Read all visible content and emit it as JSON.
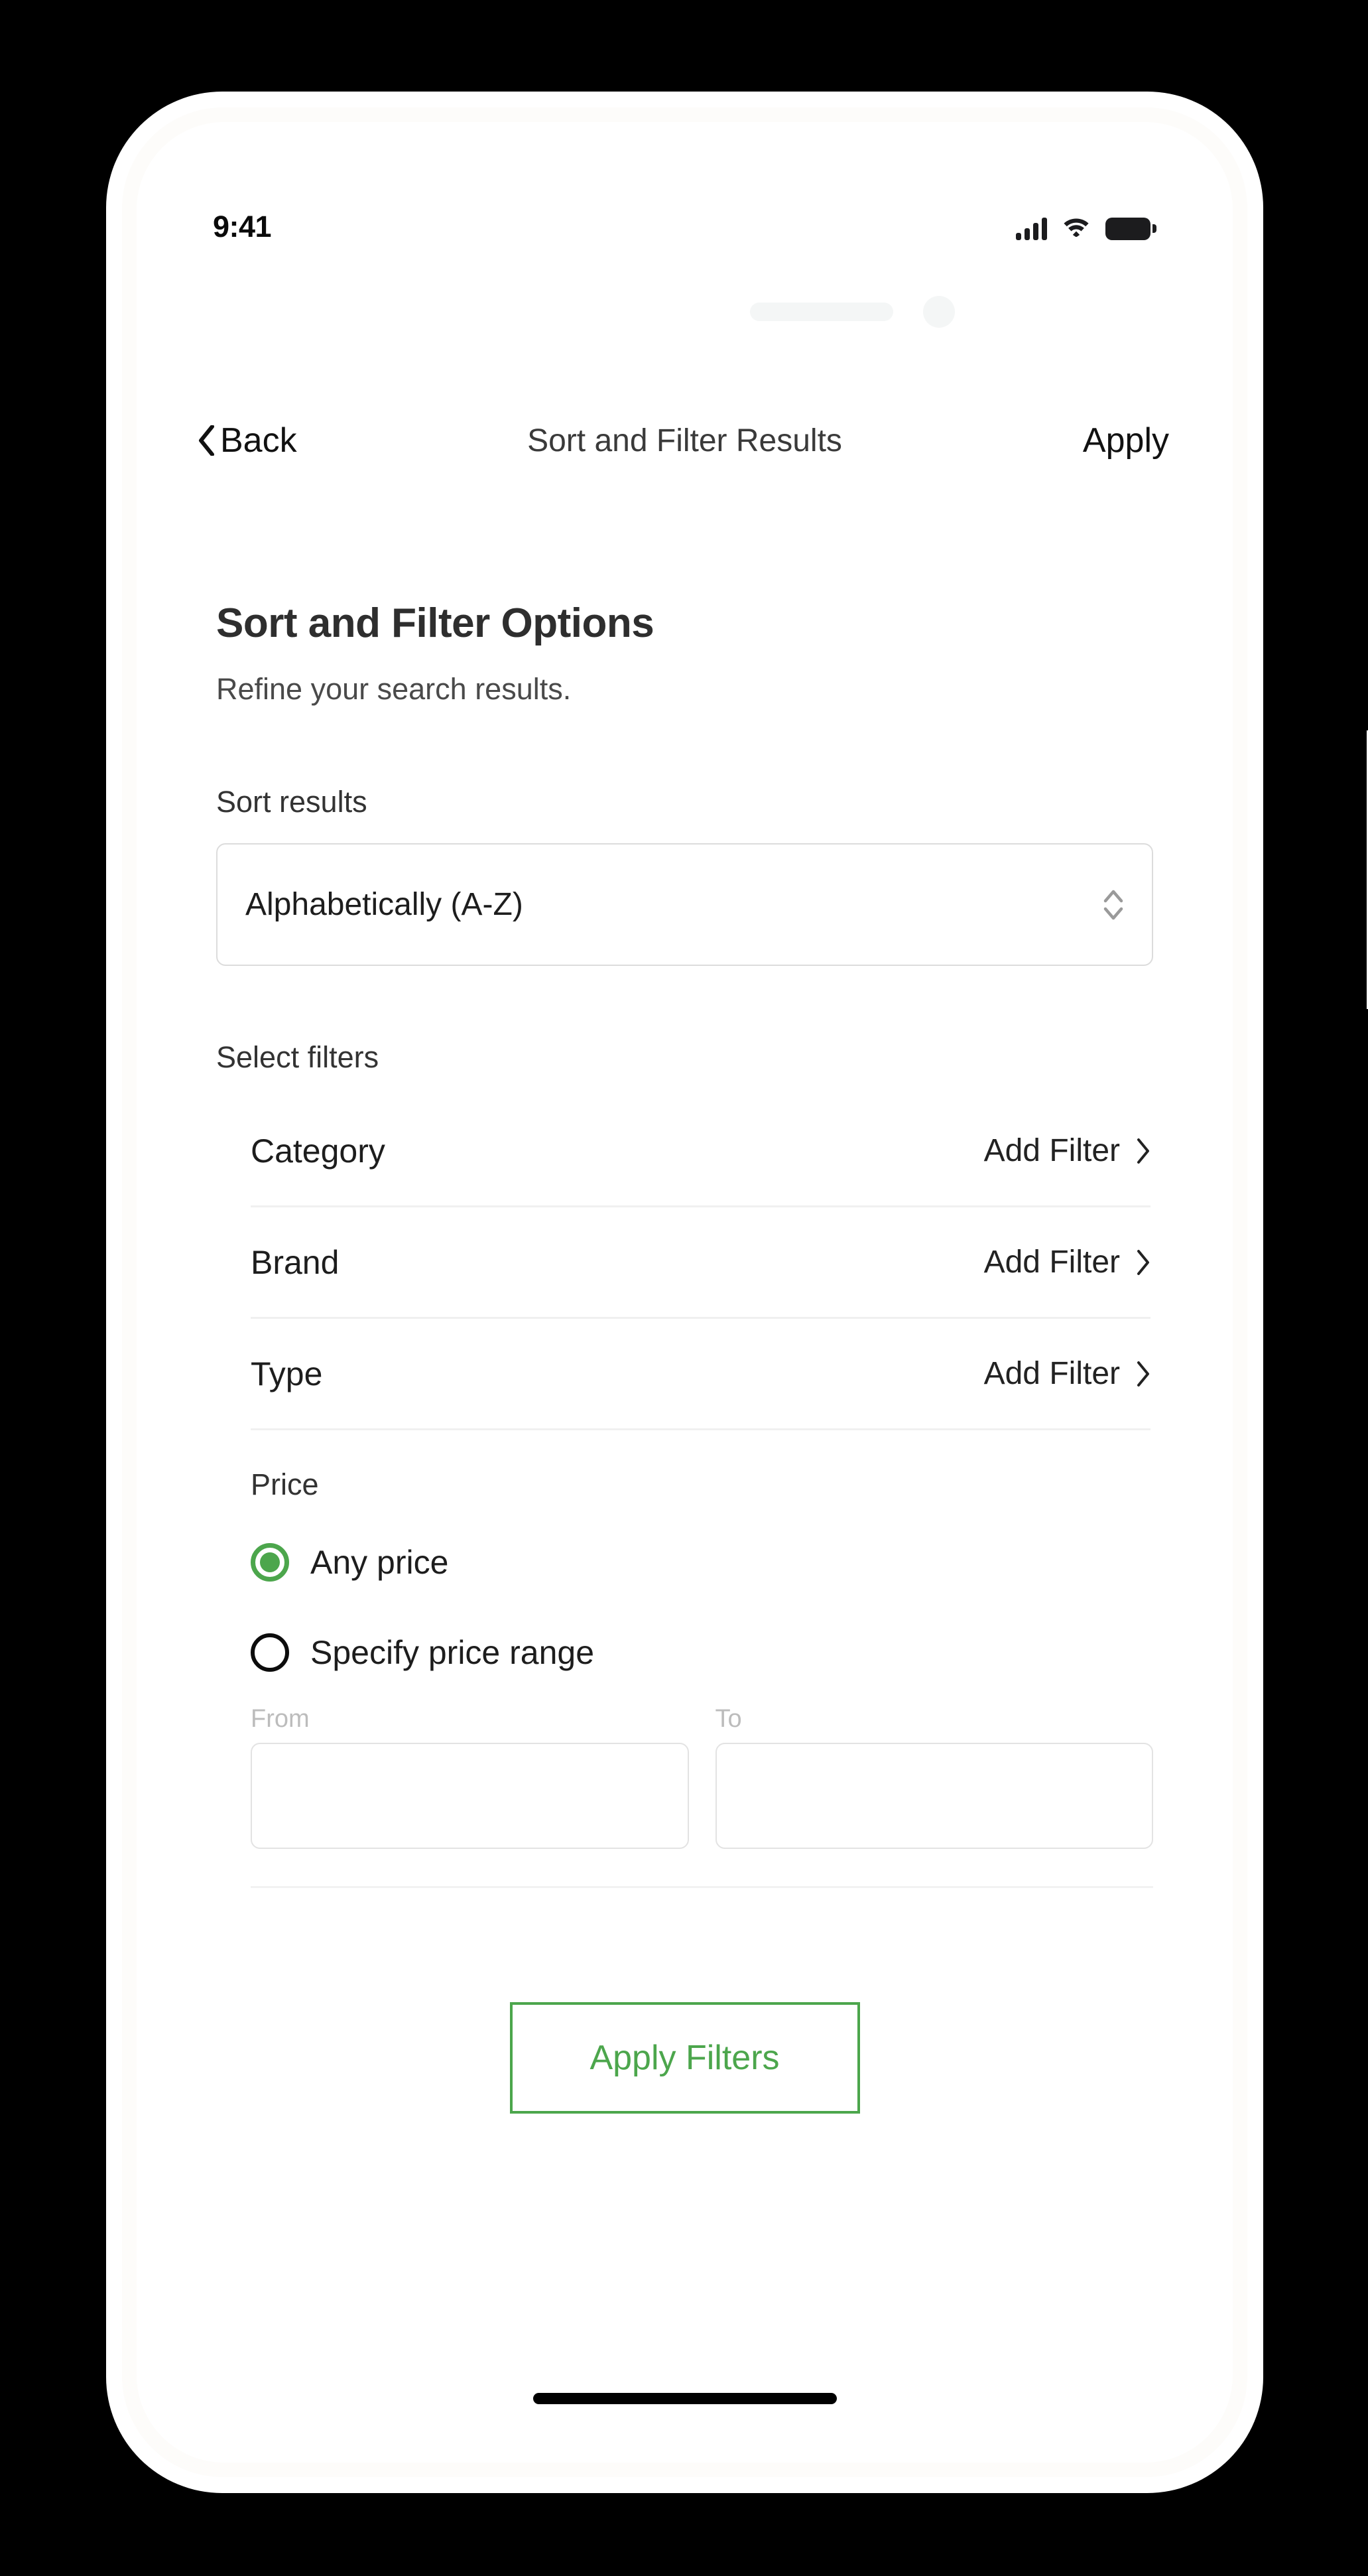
{
  "status_bar": {
    "time": "9:41",
    "icons": [
      "cellular-signal-icon",
      "wifi-icon",
      "battery-icon"
    ]
  },
  "nav_bar": {
    "back_label": "Back",
    "back_icon": "chevron-left-icon",
    "title": "Sort and Filter Results",
    "apply_label": "Apply"
  },
  "page": {
    "heading": "Sort and Filter Options",
    "subheading": "Refine your search results."
  },
  "sort": {
    "label": "Sort results",
    "selected_value": "Alphabetically (A-Z)",
    "stepper_icon": "chevron-up-down-icon"
  },
  "filters": {
    "label": "Select filters",
    "rows": [
      {
        "label": "Category",
        "action": "Add Filter",
        "icon": "chevron-right-icon"
      },
      {
        "label": "Brand",
        "action": "Add Filter",
        "icon": "chevron-right-icon"
      },
      {
        "label": "Type",
        "action": "Add Filter",
        "icon": "chevron-right-icon"
      }
    ]
  },
  "price": {
    "label": "Price",
    "options": [
      {
        "label": "Any price",
        "selected": true
      },
      {
        "label": "Specify price range",
        "selected": false
      }
    ],
    "from_label": "From",
    "from_value": "",
    "to_label": "To",
    "to_value": ""
  },
  "footer": {
    "apply_filters_label": "Apply Filters"
  },
  "colors": {
    "accent_green": "#4CA64C",
    "text_primary": "#1d1d1d",
    "text_muted": "#bcbcbc",
    "border": "#e3e3e3"
  }
}
